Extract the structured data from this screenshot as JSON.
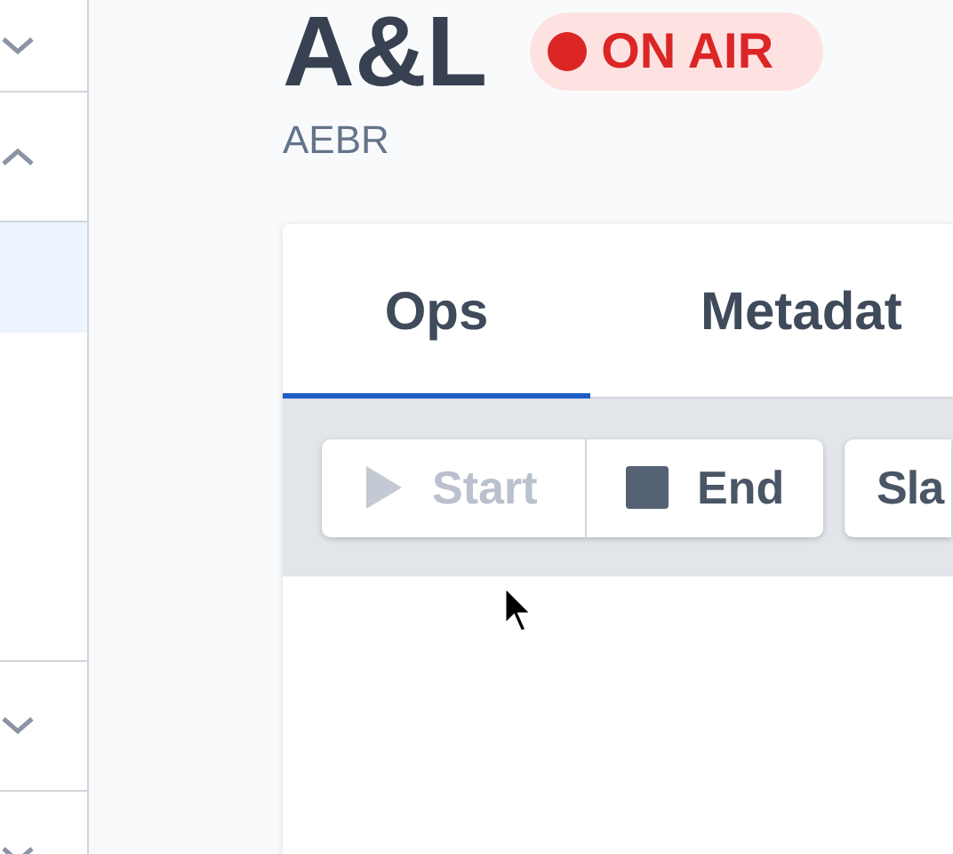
{
  "sidebar": {
    "items": [
      {
        "expanded": false
      },
      {
        "expanded": true,
        "children": [
          {
            "selected": true
          }
        ]
      },
      {
        "expanded": false
      },
      {
        "expanded": false
      }
    ]
  },
  "header": {
    "title": "A&L",
    "badge": "ON AIR",
    "subtitle": "AEBR"
  },
  "tabs": [
    {
      "label": "Ops",
      "selected": true
    },
    {
      "label": "Metadat",
      "selected": false
    }
  ],
  "toolbar": {
    "buttons": [
      {
        "label": "Start",
        "kind": "start",
        "disabled": true
      },
      {
        "label": "End",
        "kind": "end",
        "disabled": false
      },
      {
        "label": "Sla",
        "kind": "plain",
        "disabled": false
      }
    ]
  }
}
